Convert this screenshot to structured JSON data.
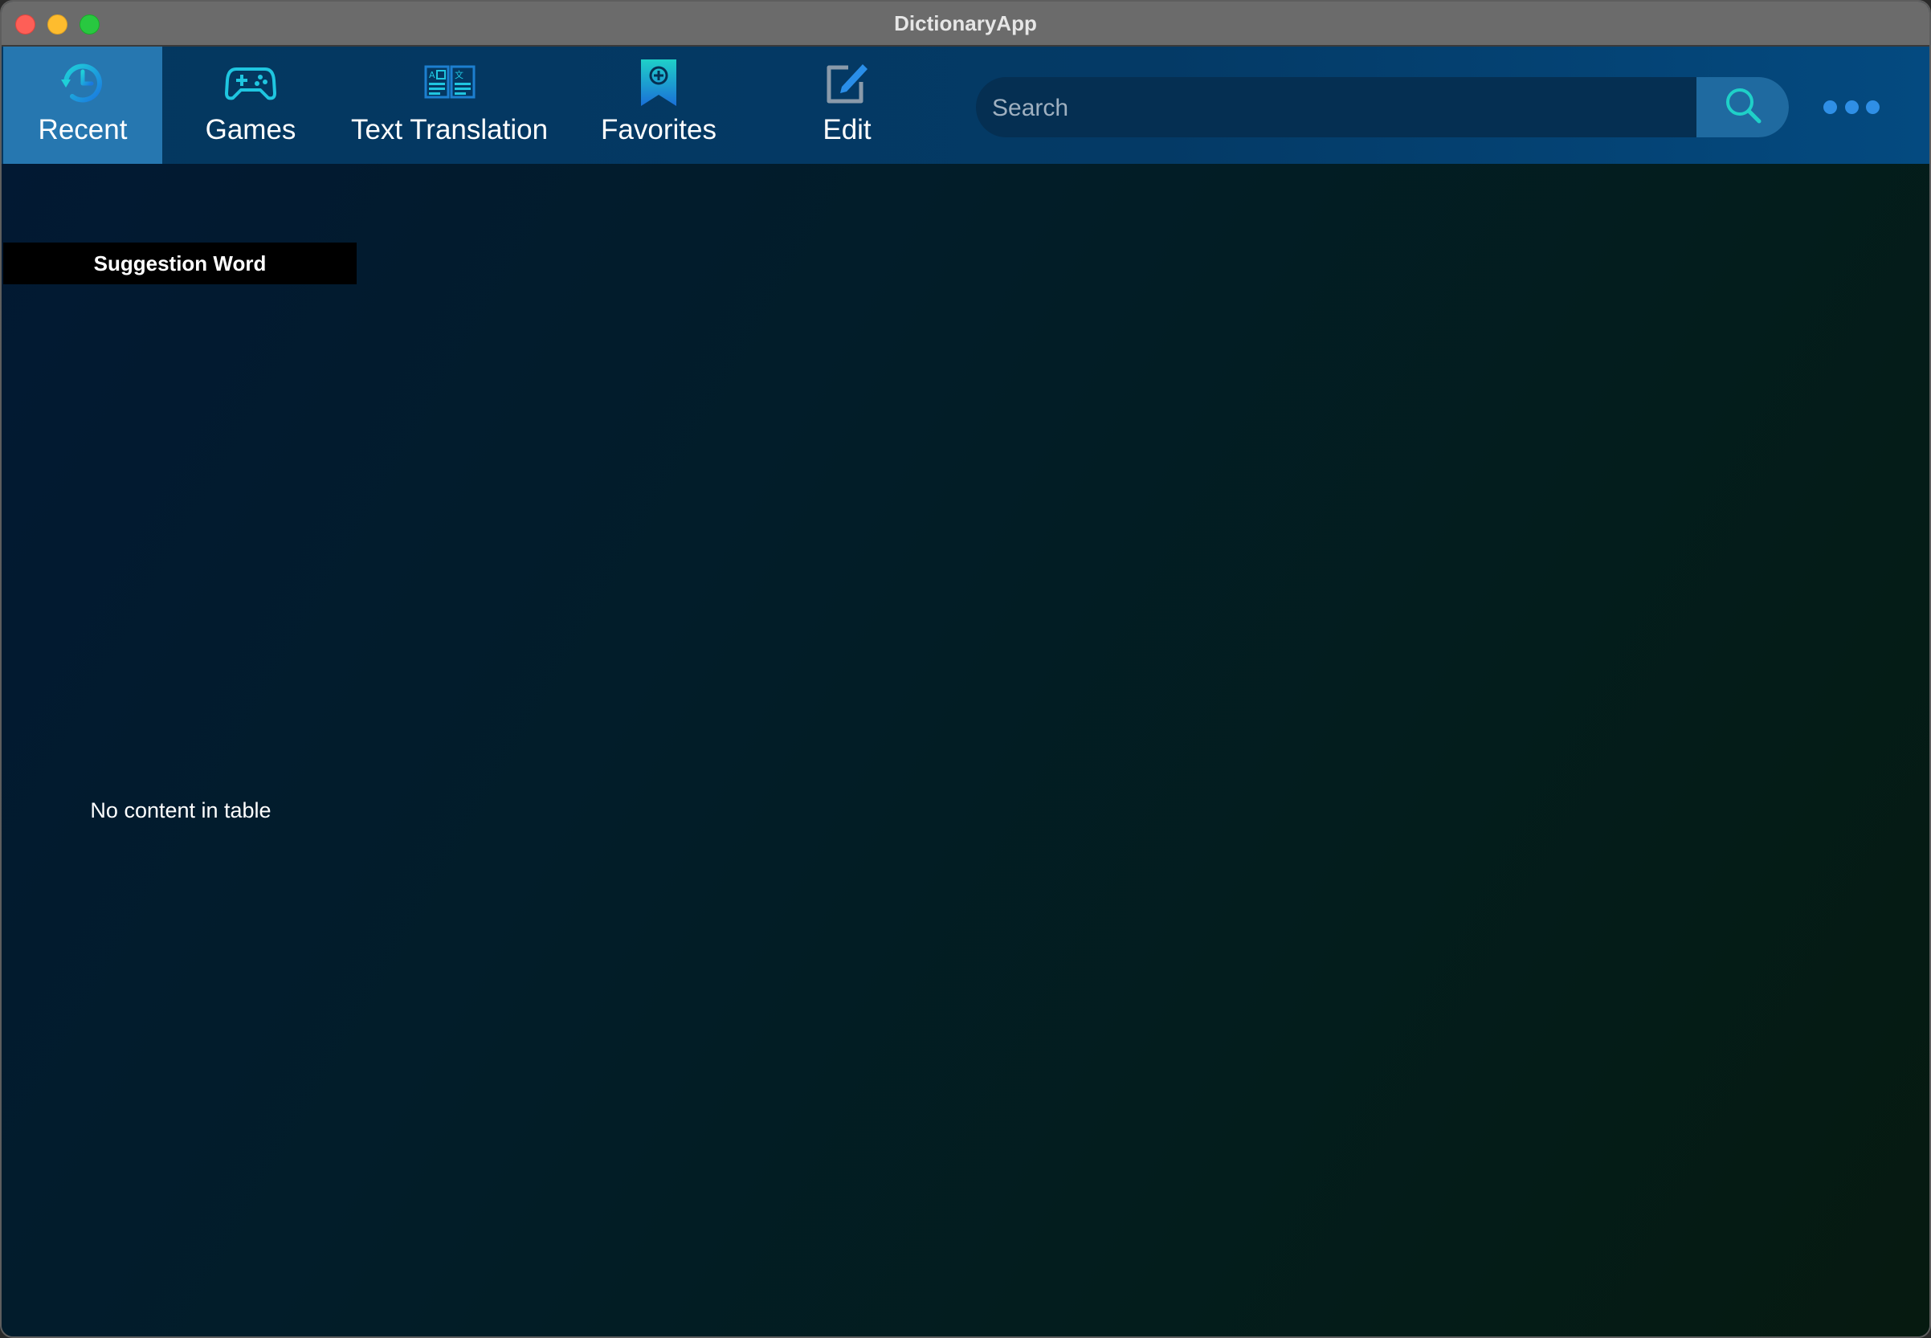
{
  "window": {
    "title": "DictionaryApp"
  },
  "toolbar": {
    "tabs": [
      {
        "label": "Recent",
        "icon": "recent-clock-icon",
        "active": true
      },
      {
        "label": "Games",
        "icon": "gamepad-icon",
        "active": false
      },
      {
        "label": "Text Translation",
        "icon": "translation-icon",
        "active": false
      },
      {
        "label": "Favorites",
        "icon": "bookmark-icon",
        "active": false
      },
      {
        "label": "Edit",
        "icon": "edit-icon",
        "active": false
      }
    ],
    "search": {
      "placeholder": "Search",
      "value": ""
    }
  },
  "content": {
    "suggestion_header": "Suggestion Word",
    "empty_message": "No content in table"
  },
  "colors": {
    "toolbar_bg": "#043a66",
    "active_tab": "#2677b0",
    "icon_accent": "#1fd0d8",
    "more_dots": "#2f8fe6"
  }
}
